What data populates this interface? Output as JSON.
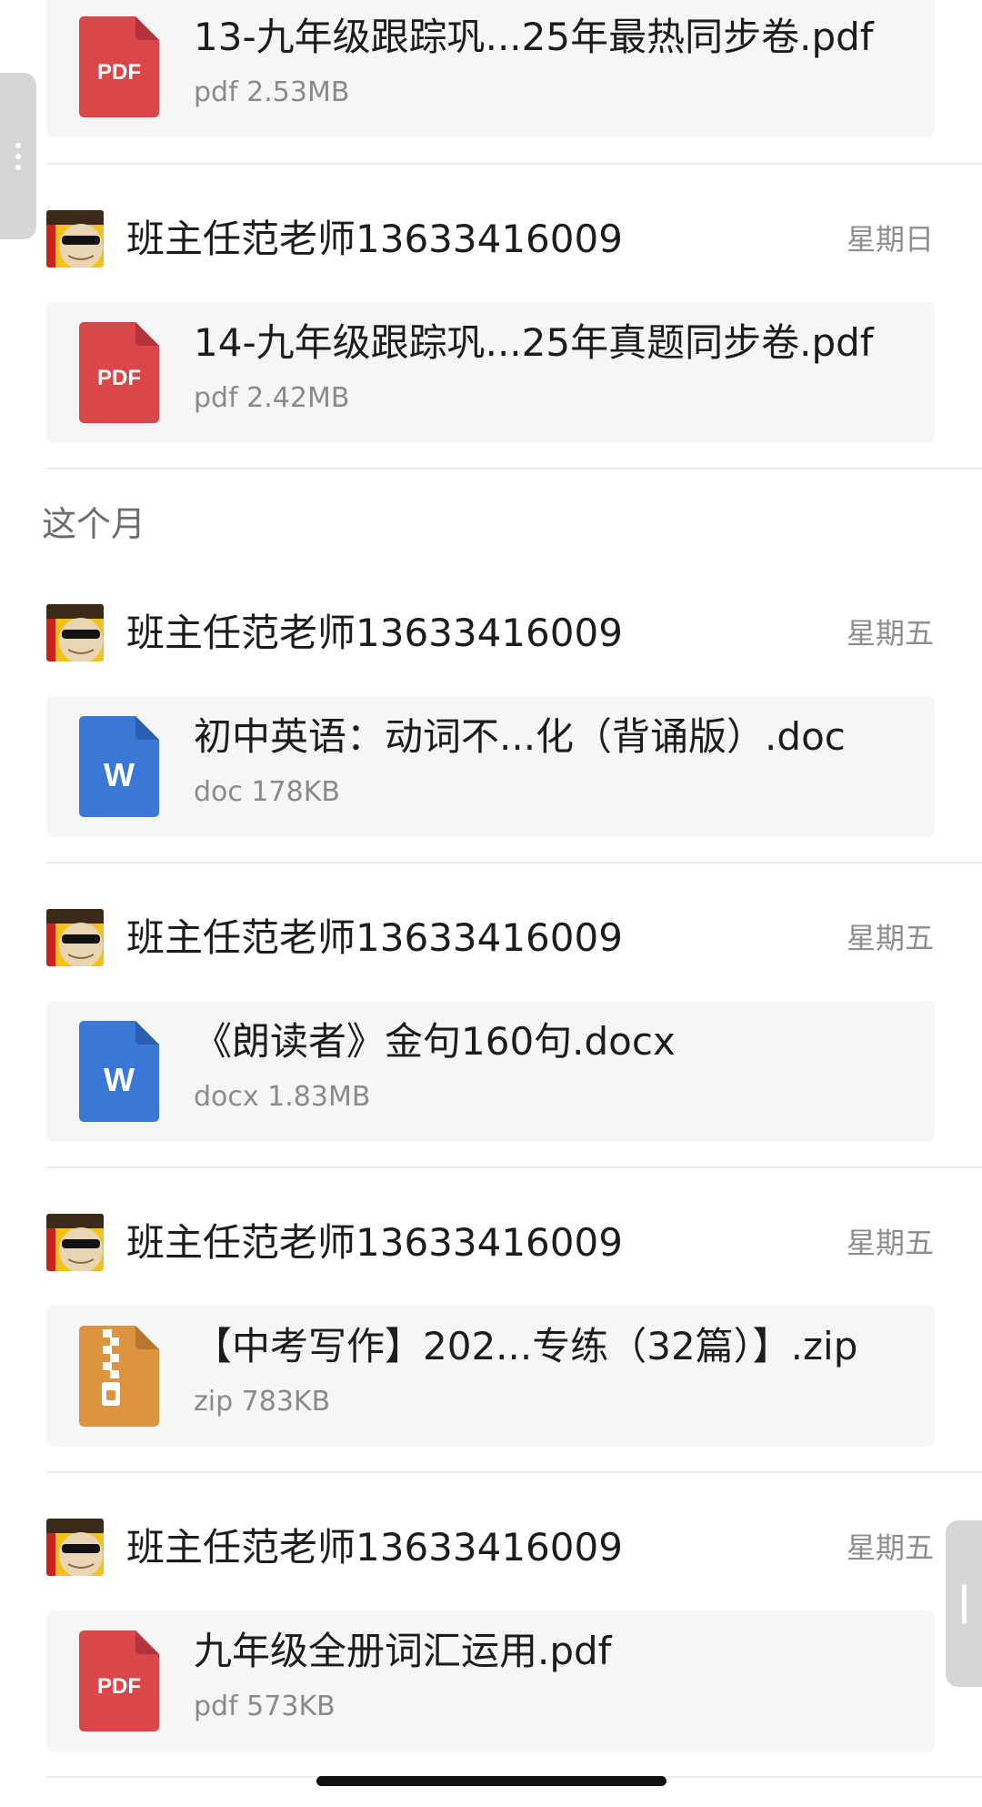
{
  "sections": [
    {
      "header": "这个月"
    }
  ],
  "messages": [
    {
      "sender": "",
      "date": "",
      "file": {
        "name": "13-九年级跟踪巩...25年最热同步卷.pdf",
        "meta": "pdf 2.53MB",
        "type": "pdf",
        "icon_label": "PDF"
      }
    },
    {
      "sender": "班主任范老师13633416009",
      "date": "星期日",
      "file": {
        "name": "14-九年级跟踪巩...25年真题同步卷.pdf",
        "meta": "pdf 2.42MB",
        "type": "pdf",
        "icon_label": "PDF"
      }
    },
    {
      "sender": "班主任范老师13633416009",
      "date": "星期五",
      "file": {
        "name": "初中英语：动词不...化（背诵版）.doc",
        "meta": "doc 178KB",
        "type": "word",
        "icon_label": "W"
      }
    },
    {
      "sender": "班主任范老师13633416009",
      "date": "星期五",
      "file": {
        "name": "《朗读者》金句160句.docx",
        "meta": "docx 1.83MB",
        "type": "word",
        "icon_label": "W"
      }
    },
    {
      "sender": "班主任范老师13633416009",
      "date": "星期五",
      "file": {
        "name": "【中考写作】202...专练（32篇）】.zip",
        "meta": "zip 783KB",
        "type": "zip",
        "icon_label": ""
      }
    },
    {
      "sender": "班主任范老师13633416009",
      "date": "星期五",
      "file": {
        "name": "九年级全册词汇运用.pdf",
        "meta": "pdf 573KB",
        "type": "pdf",
        "icon_label": "PDF"
      }
    }
  ],
  "colors": {
    "pdf": "#d9474b",
    "word": "#3a78d8",
    "zip": "#dd9440",
    "card_bg": "#f6f6f6",
    "secondary_text": "#8d8d8d"
  }
}
